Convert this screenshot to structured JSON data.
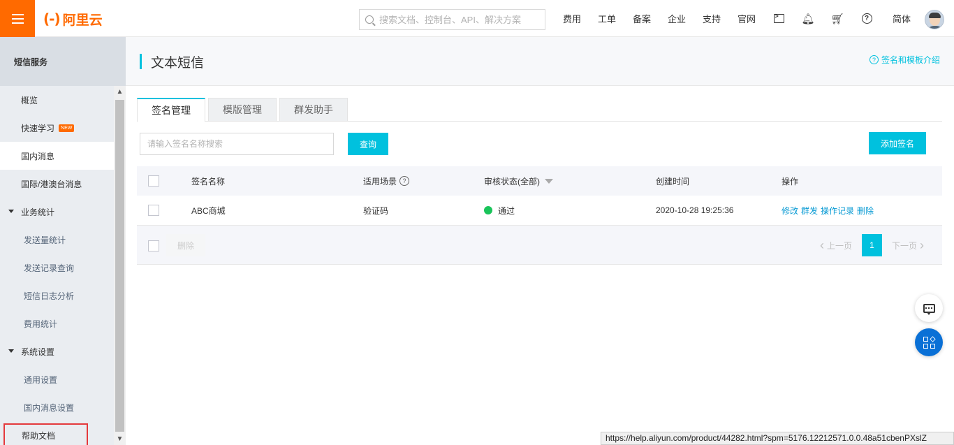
{
  "topbar": {
    "logo_mark": "(-)",
    "logo_text": "阿里云",
    "search_placeholder": "搜索文档、控制台、API、解决方案",
    "nav": [
      "费用",
      "工单",
      "备案",
      "企业",
      "支持",
      "官网"
    ],
    "icons": [
      "terminal-icon",
      "bell-icon",
      "cart-icon",
      "help-icon"
    ],
    "lang": "简体"
  },
  "sidebar": {
    "header": "短信服务",
    "items": [
      {
        "label": "概览",
        "kind": "top"
      },
      {
        "label": "快速学习",
        "kind": "top",
        "badge": "NEW"
      },
      {
        "label": "国内消息",
        "kind": "top",
        "active": true
      },
      {
        "label": "国际/港澳台消息",
        "kind": "top"
      },
      {
        "label": "业务统计",
        "kind": "group"
      },
      {
        "label": "发送量统计",
        "kind": "sub"
      },
      {
        "label": "发送记录查询",
        "kind": "sub"
      },
      {
        "label": "短信日志分析",
        "kind": "sub"
      },
      {
        "label": "费用统计",
        "kind": "sub"
      },
      {
        "label": "系统设置",
        "kind": "group"
      },
      {
        "label": "通用设置",
        "kind": "sub"
      },
      {
        "label": "国内消息设置",
        "kind": "sub"
      },
      {
        "label": "帮助文档",
        "kind": "help"
      }
    ]
  },
  "page": {
    "title": "文本短信",
    "intro_link": "签名和模板介绍"
  },
  "tabs": [
    {
      "label": "签名管理",
      "active": true
    },
    {
      "label": "模版管理",
      "active": false
    },
    {
      "label": "群发助手",
      "active": false
    }
  ],
  "toolbar": {
    "search_placeholder": "请输入签名名称搜索",
    "query_label": "查询",
    "add_label": "添加签名"
  },
  "table": {
    "columns": [
      "签名名称",
      "适用场景",
      "审核状态(全部)",
      "创建时间",
      "操作"
    ],
    "rows": [
      {
        "name": "ABC商城",
        "scene": "验证码",
        "status": "通过",
        "status_color": "#1ac45a",
        "created": "2020-10-28 19:25:36",
        "actions": [
          "修改",
          "群发",
          "操作记录",
          "删除"
        ]
      }
    ],
    "delete_label": "删除",
    "pager": {
      "prev": "上一页",
      "current": "1",
      "next": "下一页"
    }
  },
  "status_url": "https://help.aliyun.com/product/44282.html?spm=5176.12212571.0.0.48a51cbenPXslZ",
  "colors": {
    "brand": "#ff6a00",
    "accent": "#00c1de",
    "link": "#0a9bd4"
  }
}
